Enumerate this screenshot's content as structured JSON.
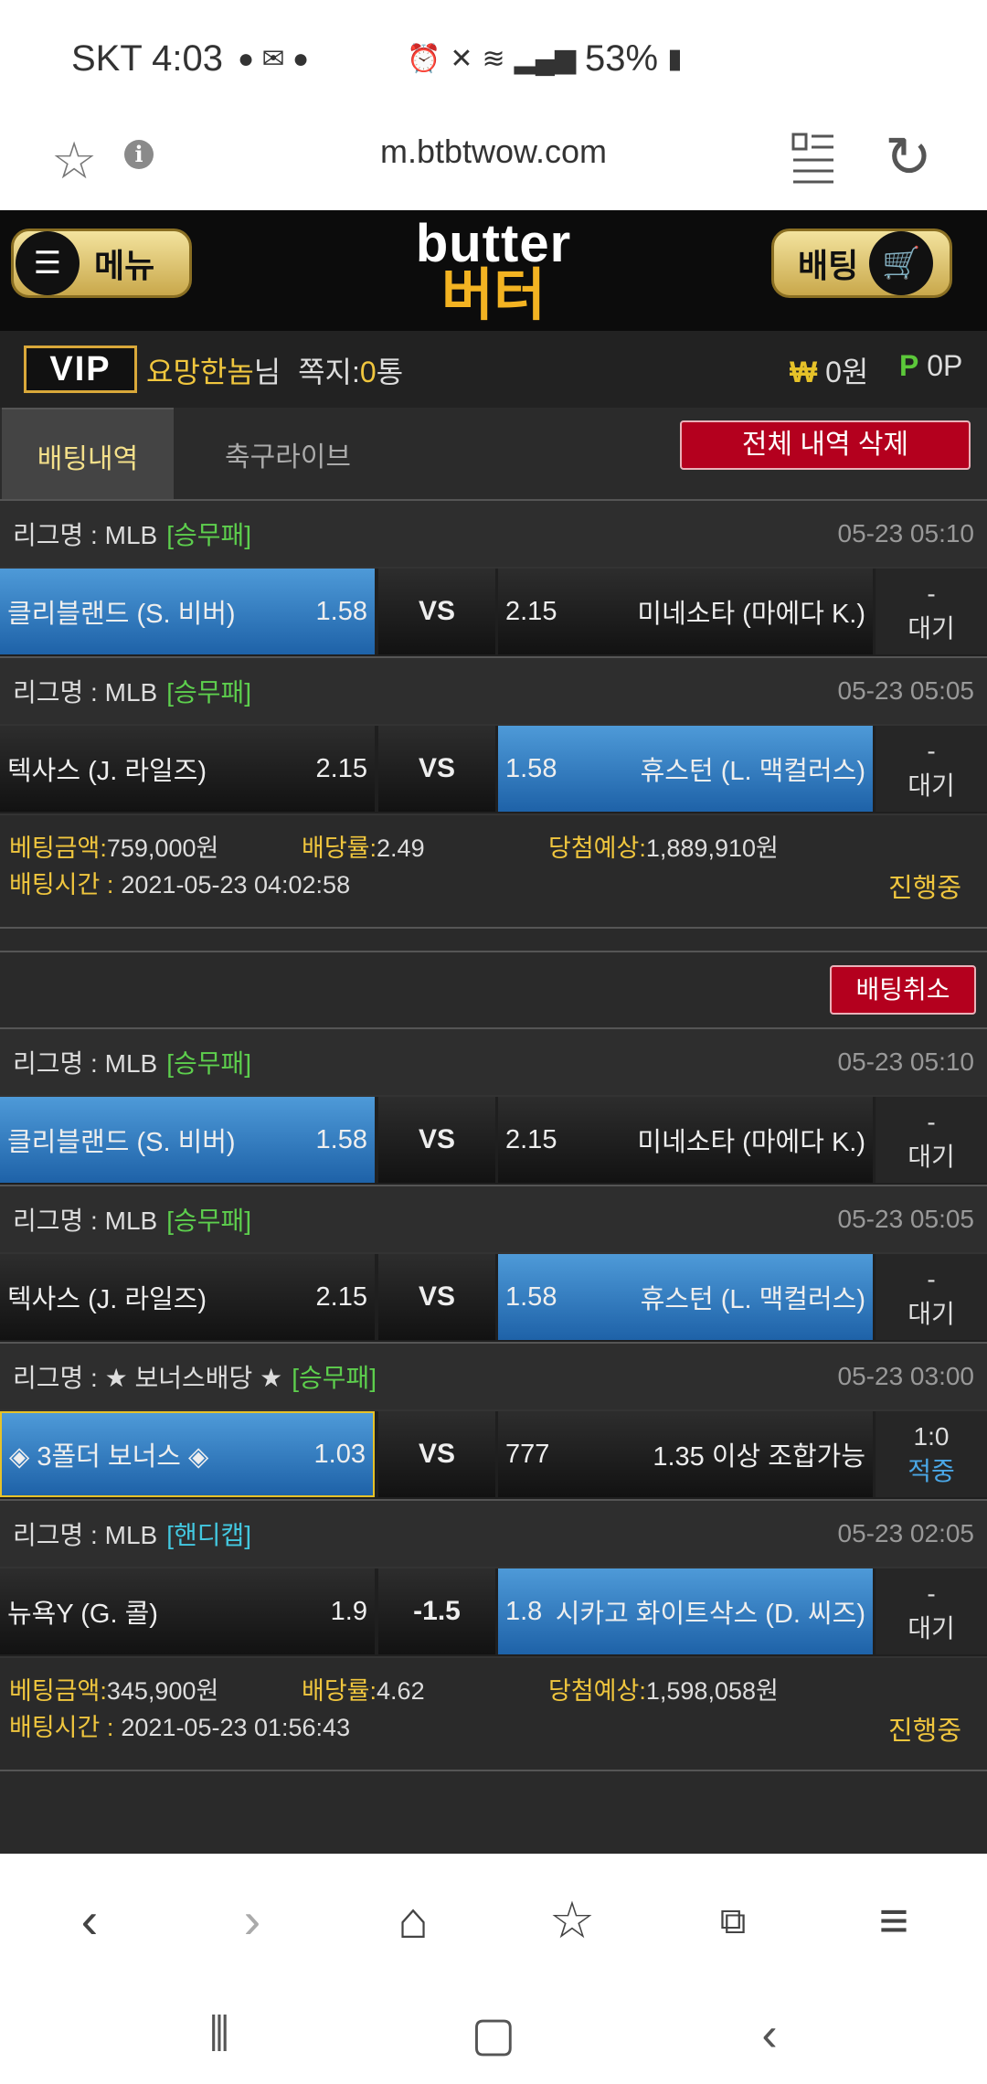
{
  "status_bar": {
    "carrier_time": "SKT 4:03",
    "battery": "53%"
  },
  "browser": {
    "url": "m.btbtwow.com"
  },
  "header": {
    "menu_label": "메뉴",
    "logo_en": "butter",
    "logo_ko": "버터",
    "bet_label": "배팅"
  },
  "user": {
    "badge": "VIP",
    "name": "요망한놈",
    "suffix": "님",
    "message_label": "쪽지:",
    "message_count": "0",
    "message_unit": "통",
    "won_symbol": "₩",
    "won_amount": "0원",
    "point_symbol": "P",
    "point_amount": "0P"
  },
  "tabs": {
    "betting_history": "배팅내역",
    "soccer_live": "축구라이브",
    "delete_all": "전체 내역 삭제"
  },
  "bets": [
    {
      "games": [
        {
          "league": "리그명 : MLB",
          "type": "[승무패]",
          "type_color": "green",
          "time": "05-23 05:10",
          "home": "클리블랜드 (S. 비버)",
          "home_odds": "1.58",
          "middle": "VS",
          "away_odds": "2.15",
          "away": "미네소타 (마에다 K.)",
          "selected": "home",
          "score": "-",
          "status": "대기"
        },
        {
          "league": "리그명 : MLB",
          "type": "[승무패]",
          "type_color": "green",
          "time": "05-23 05:05",
          "home": "텍사스 (J. 라일즈)",
          "home_odds": "2.15",
          "middle": "VS",
          "away_odds": "1.58",
          "away": "휴스턴 (L. 맥컬러스)",
          "selected": "away",
          "score": "-",
          "status": "대기"
        }
      ],
      "amount_label": "베팅금액:",
      "amount": "759,000원",
      "odds_label": "배당률:",
      "odds": "2.49",
      "expected_label": "당첨예상:",
      "expected": "1,889,910원",
      "time_label": "배팅시간 :",
      "time": "2021-05-23 04:02:58",
      "state": "진행중"
    },
    {
      "cancel_label": "배팅취소",
      "games": [
        {
          "league": "리그명 : MLB",
          "type": "[승무패]",
          "type_color": "green",
          "time": "05-23 05:10",
          "home": "클리블랜드 (S. 비버)",
          "home_odds": "1.58",
          "middle": "VS",
          "away_odds": "2.15",
          "away": "미네소타 (마에다 K.)",
          "selected": "home",
          "score": "-",
          "status": "대기"
        },
        {
          "league": "리그명 : MLB",
          "type": "[승무패]",
          "type_color": "green",
          "time": "05-23 05:05",
          "home": "텍사스 (J. 라일즈)",
          "home_odds": "2.15",
          "middle": "VS",
          "away_odds": "1.58",
          "away": "휴스턴 (L. 맥컬러스)",
          "selected": "away",
          "score": "-",
          "status": "대기"
        },
        {
          "league": "리그명 : ★ 보너스배당 ★",
          "type": "[승무패]",
          "type_color": "green",
          "time": "05-23 03:00",
          "home": "◈ 3폴더 보너스 ◈",
          "home_odds": "1.03",
          "middle": "VS",
          "away_odds": "777",
          "away": "1.35 이상 조합가능",
          "selected": "home-bonus",
          "score": "1:0",
          "status": "적중"
        },
        {
          "league": "리그명 : MLB",
          "type": "[핸디캡]",
          "type_color": "cyan",
          "time": "05-23 02:05",
          "home": "뉴욕Y (G. 콜)",
          "home_odds": "1.9",
          "middle": "-1.5",
          "away_odds": "1.8",
          "away": "시카고 화이트삭스 (D. 씨즈)",
          "selected": "away",
          "score": "-",
          "status": "대기"
        }
      ],
      "amount_label": "베팅금액:",
      "amount": "345,900원",
      "odds_label": "배당률:",
      "odds": "4.62",
      "expected_label": "당첨예상:",
      "expected": "1,598,058원",
      "time_label": "배팅시간 :",
      "time": "2021-05-23 01:56:43",
      "state": "진행중"
    }
  ],
  "colors": {
    "gold": "#f0c63e",
    "selected_blue": "#2f7cc4",
    "delete_red": "#b4001e",
    "green": "#5dcf4d",
    "cyan": "#43c8e0"
  },
  "icons": {
    "browser_nav": [
      "back-icon",
      "forward-icon",
      "home-icon",
      "bookmarks-icon",
      "tabs-icon",
      "menu-icon"
    ],
    "system_nav": [
      "recents-icon",
      "home-circle-icon",
      "system-back-icon"
    ],
    "tab_count": "1"
  }
}
